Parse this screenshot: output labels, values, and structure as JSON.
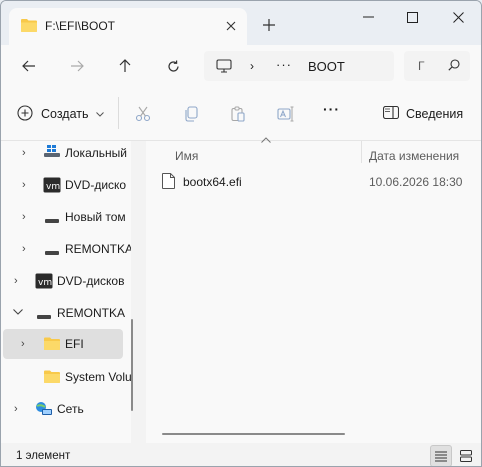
{
  "tab": {
    "title": "F:\\EFI\\BOOT",
    "close_icon": "×",
    "new_tab_icon": "+"
  },
  "address": {
    "current_folder": "BOOT",
    "overflow": "···",
    "separator": "›"
  },
  "search": {
    "placeholder": "Г"
  },
  "commands": {
    "create_label": "Создать",
    "more_label": "···",
    "details_label": "Сведения"
  },
  "tree": {
    "items": [
      {
        "label": "Локальный",
        "icon": "drive-windows-icon",
        "expanded": false
      },
      {
        "label": "DVD-диско",
        "icon": "vm-disc-icon",
        "expanded": false
      },
      {
        "label": "Новый том",
        "icon": "drive-icon",
        "expanded": false
      },
      {
        "label": "REMONTKA",
        "icon": "drive-icon",
        "expanded": false
      },
      {
        "label": "DVD-дисков",
        "icon": "vm-disc-icon",
        "expanded": false
      },
      {
        "label": "REMONTKA",
        "icon": "drive-icon",
        "expanded": true
      },
      {
        "label": "EFI",
        "icon": "folder-icon",
        "expanded": false,
        "selected": true
      },
      {
        "label": "System Volu",
        "icon": "folder-icon",
        "expanded": false
      },
      {
        "label": "Сеть",
        "icon": "network-icon",
        "expanded": false
      }
    ]
  },
  "files": {
    "columns": {
      "name": "Имя",
      "date": "Дата изменения"
    },
    "rows": [
      {
        "name": "bootx64.efi",
        "date": "10.06.2026 18:30"
      }
    ]
  },
  "status": {
    "count": "1 элемент"
  },
  "colors": {
    "accent": "#0067c0",
    "folder": "#f8c94a",
    "selected": "#dfdfdf"
  }
}
